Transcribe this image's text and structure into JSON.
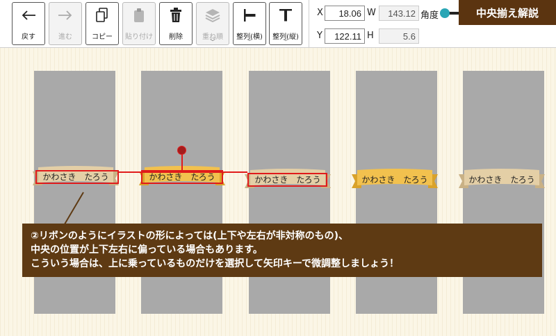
{
  "toolbar": {
    "buttons": [
      {
        "label": "戻す",
        "icon": "arrow-left-icon",
        "enabled": true
      },
      {
        "label": "進む",
        "icon": "arrow-right-icon",
        "enabled": false
      },
      {
        "label": "コピー",
        "icon": "copy-icon",
        "enabled": true
      },
      {
        "label": "貼り付け",
        "icon": "paste-icon",
        "enabled": false
      },
      {
        "label": "削除",
        "icon": "trash-icon",
        "enabled": true
      },
      {
        "label": "重ね順",
        "icon": "layers-icon",
        "enabled": false
      },
      {
        "label": "整列(横)",
        "icon": "align-horizontal-icon",
        "enabled": true
      },
      {
        "label": "整列(縦)",
        "icon": "align-vertical-icon",
        "enabled": true
      }
    ],
    "caret": "﹀"
  },
  "props": {
    "x_label": "X",
    "x_value": "18.06",
    "w_label": "W",
    "w_value": "143.12",
    "y_label": "Y",
    "y_value": "122.11",
    "h_label": "H",
    "h_value": "5.6",
    "angle_label": "角度",
    "angle_icon": "angle-slider-icon"
  },
  "banner": {
    "title": "中央揃え解説"
  },
  "ribbons": [
    {
      "name": "かわさき　たろう"
    },
    {
      "name": "かわさき　たろう"
    },
    {
      "name": "かわさき　たろう"
    },
    {
      "name": "かわさき　たろう"
    },
    {
      "name": "かわさき　たろう"
    }
  ],
  "callout": {
    "line1": "②リボンのようにイラストの形によっては(上下や左右が非対称のもの)、",
    "line2": "中央の位置が上下左右に偏っている場合もあります。",
    "line3": "こういう場合は、上に乗っているものだけを選択して矢印キーで微調整しましょう！"
  },
  "colors": {
    "banner_bg": "#5b3410",
    "callout_bg": "#5e3a13",
    "selection": "#e01b1b",
    "ribbon_gold": "#f2c14e",
    "ribbon_beige": "#e4cfa6",
    "slider_knob": "#2aa6b5"
  }
}
